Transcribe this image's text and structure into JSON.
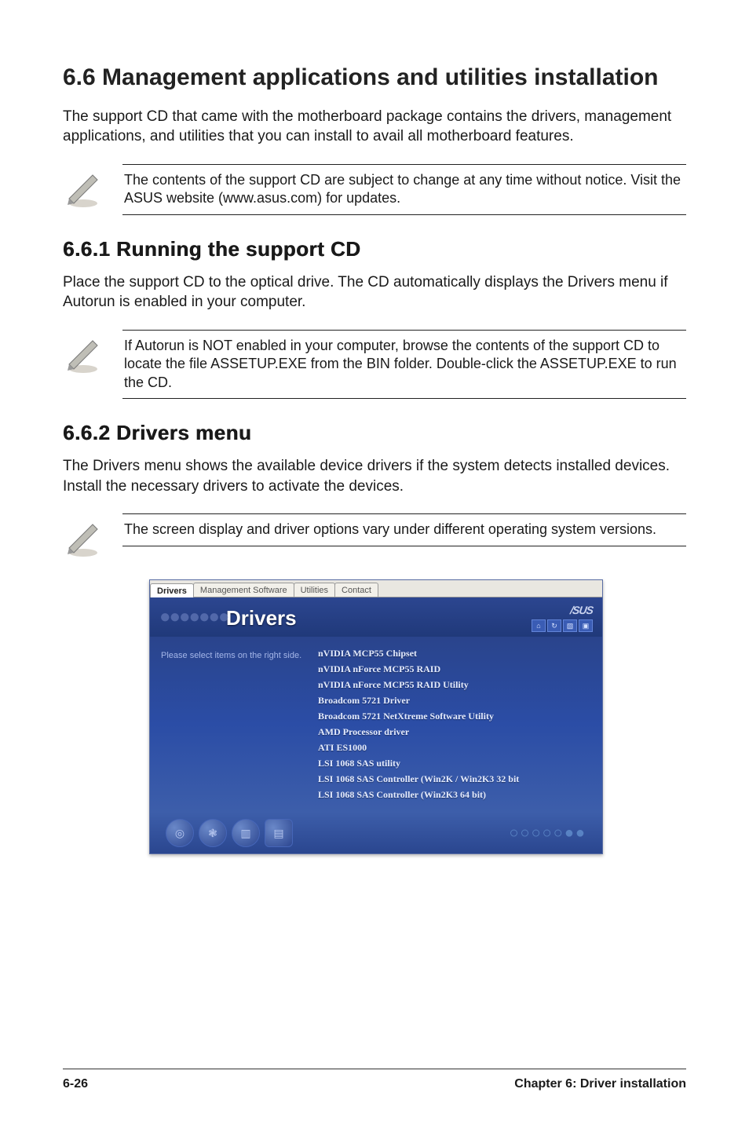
{
  "section": {
    "title": "6.6 Management applications and utilities installation",
    "intro": "The support CD that came with the motherboard package contains the drivers, management applications, and utilities that you can install to avail all  motherboard features.",
    "note1": "The contents of the support CD are subject to change at any time without notice. Visit the ASUS website (www.asus.com) for updates."
  },
  "sub1": {
    "title": "6.6.1 Running the support CD",
    "body": "Place the support CD to the optical drive. The CD automatically displays the Drivers menu if Autorun is enabled in your computer.",
    "note": "If Autorun is NOT enabled in your computer, browse the contents of the support CD to locate the file ASSETUP.EXE from the BIN folder. Double-click the ASSETUP.EXE to run the CD."
  },
  "sub2": {
    "title": "6.6.2 Drivers menu",
    "body": "The Drivers menu shows the available device drivers if the system detects installed devices. Install the necessary drivers to activate the devices.",
    "note": "The screen display and driver options vary under different operating system versions."
  },
  "drivers_window": {
    "tabs": [
      "Drivers",
      "Management Software",
      "Utilities",
      "Contact"
    ],
    "brand": "/SUS",
    "heading": "Drivers",
    "left_prompt": "Please select items on the right side.",
    "items": [
      "nVIDIA MCP55 Chipset",
      "nVIDIA nForce MCP55 RAID",
      "nVIDIA nForce MCP55 RAID Utility",
      "Broadcom 5721 Driver",
      "Broadcom 5721 NetXtreme Software Utility",
      "AMD Processor driver",
      "ATI ES1000",
      "LSI 1068 SAS utility",
      "LSI 1068 SAS Controller (Win2K / Win2K3 32 bit",
      "LSI 1068 SAS Controller (Win2K3 64 bit)"
    ]
  },
  "footer": {
    "page_num": "6-26",
    "chapter": "Chapter 6: Driver installation"
  }
}
